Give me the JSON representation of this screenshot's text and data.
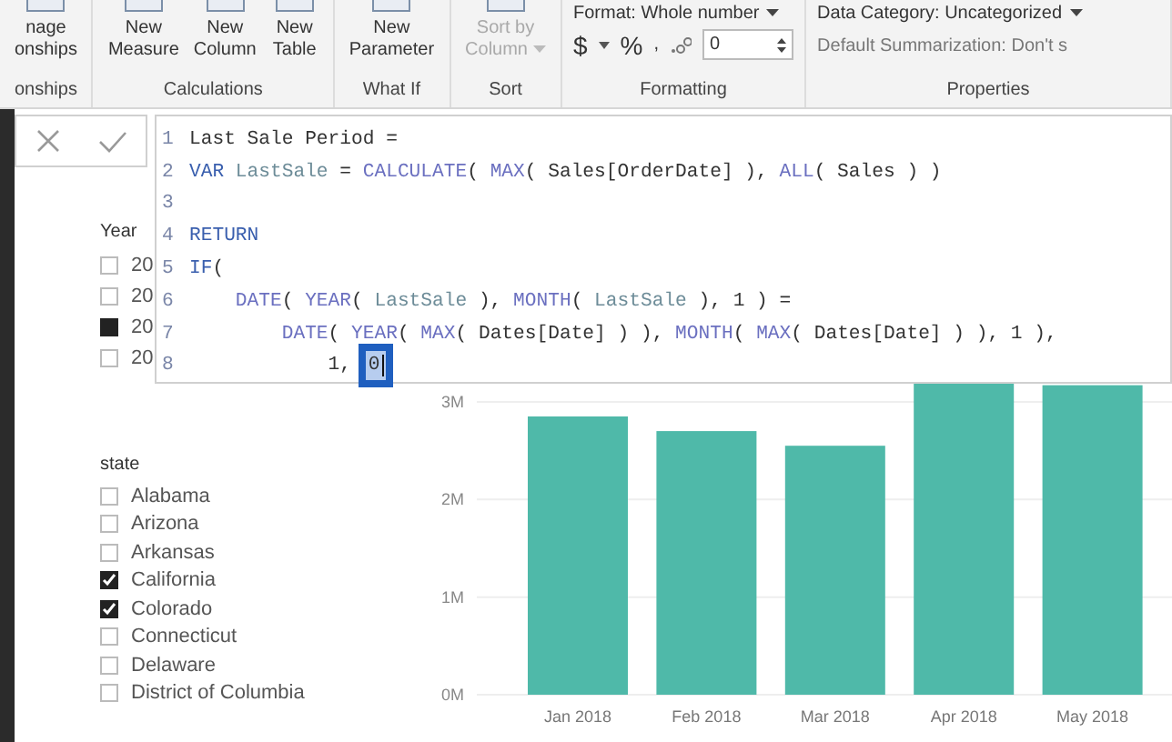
{
  "ribbon": {
    "groups": [
      {
        "kind": "buttons",
        "label": "onships",
        "buttons": [
          {
            "lines": [
              "nage",
              "onships"
            ],
            "disabled": false,
            "menu": false
          }
        ]
      },
      {
        "kind": "buttons",
        "label": "Calculations",
        "buttons": [
          {
            "lines": [
              "New",
              "Measure"
            ],
            "disabled": false,
            "menu": false
          },
          {
            "lines": [
              "New",
              "Column"
            ],
            "disabled": false,
            "menu": false
          },
          {
            "lines": [
              "New",
              "Table"
            ],
            "disabled": false,
            "menu": false
          }
        ]
      },
      {
        "kind": "buttons",
        "label": "What If",
        "buttons": [
          {
            "lines": [
              "New",
              "Parameter"
            ],
            "disabled": false,
            "menu": false
          }
        ]
      },
      {
        "kind": "buttons",
        "label": "Sort",
        "buttons": [
          {
            "lines": [
              "Sort by",
              "Column"
            ],
            "disabled": true,
            "menu": true
          }
        ]
      },
      {
        "kind": "formatting",
        "label": "Formatting",
        "format": "Format: Whole number",
        "currency": "$",
        "percent": "%",
        "comma": ",",
        "decimals": "0"
      },
      {
        "kind": "properties",
        "label": "Properties",
        "category": "Data Category: Uncategorized",
        "summarization": "Default Summarization: Don't s"
      }
    ]
  },
  "formula_bar": {
    "lines": [
      {
        "number": "1",
        "tokens": [
          {
            "kind": "text",
            "text": "Last Sale Period ="
          }
        ]
      },
      {
        "number": "2",
        "tokens": [
          {
            "kind": "keyword",
            "text": "VAR"
          },
          {
            "kind": "variable",
            "text": " LastSale"
          },
          {
            "kind": "text",
            "text": " = "
          },
          {
            "kind": "function",
            "text": "CALCULATE"
          },
          {
            "kind": "text",
            "text": "( "
          },
          {
            "kind": "function",
            "text": "MAX"
          },
          {
            "kind": "text",
            "text": "( Sales[OrderDate] ), "
          },
          {
            "kind": "function",
            "text": "ALL"
          },
          {
            "kind": "text",
            "text": "( Sales ) )"
          }
        ]
      },
      {
        "number": "3"
      },
      {
        "number": "4",
        "tokens": [
          {
            "kind": "keyword",
            "text": "RETURN"
          }
        ]
      },
      {
        "number": "5",
        "tokens": [
          {
            "kind": "keyword",
            "text": "IF"
          },
          {
            "kind": "text",
            "text": "("
          }
        ]
      },
      {
        "number": "6",
        "tokens": [
          {
            "kind": "function",
            "text": "    DATE"
          },
          {
            "kind": "text",
            "text": "( "
          },
          {
            "kind": "function",
            "text": "YEAR"
          },
          {
            "kind": "text",
            "text": "( "
          },
          {
            "kind": "variable",
            "text": "LastSale"
          },
          {
            "kind": "text",
            "text": " ), "
          },
          {
            "kind": "function",
            "text": "MONTH"
          },
          {
            "kind": "text",
            "text": "( "
          },
          {
            "kind": "variable",
            "text": "LastSale"
          },
          {
            "kind": "text",
            "text": " ), 1 ) ="
          }
        ]
      },
      {
        "number": "7",
        "tokens": [
          {
            "kind": "function",
            "text": "        DATE"
          },
          {
            "kind": "text",
            "text": "( "
          },
          {
            "kind": "function",
            "text": "YEAR"
          },
          {
            "kind": "text",
            "text": "( "
          },
          {
            "kind": "function",
            "text": "MAX"
          },
          {
            "kind": "text",
            "text": "( Dates[Date] ) ), "
          },
          {
            "kind": "function",
            "text": "MONTH"
          },
          {
            "kind": "text",
            "text": "( "
          },
          {
            "kind": "function",
            "text": "MAX"
          },
          {
            "kind": "text",
            "text": "( Dates[Date] ) ), 1 ),"
          }
        ]
      },
      {
        "number": "8",
        "tokens": [
          {
            "kind": "text",
            "text": "            1, "
          },
          {
            "kind": "selection",
            "text": "0"
          }
        ]
      }
    ]
  },
  "slicers": [
    {
      "title": "Year",
      "kind": "single_select",
      "items": [
        {
          "label": "20",
          "checked": false
        },
        {
          "label": "20",
          "checked": false
        },
        {
          "label": "20",
          "checked": true
        },
        {
          "label": "20",
          "checked": false
        }
      ]
    },
    {
      "title": "state",
      "kind": "multi_select",
      "items": [
        {
          "label": "Alabama",
          "checked": false
        },
        {
          "label": "Arizona",
          "checked": false
        },
        {
          "label": "Arkansas",
          "checked": false
        },
        {
          "label": "California",
          "checked": true
        },
        {
          "label": "Colorado",
          "checked": true
        },
        {
          "label": "Connecticut",
          "checked": false
        },
        {
          "label": "Delaware",
          "checked": false
        },
        {
          "label": "District of Columbia",
          "checked": false
        }
      ]
    }
  ],
  "chart": {
    "chart_data": {
      "type": "bar",
      "categories": [
        "Jan 2018",
        "Feb 2018",
        "Mar 2018",
        "Apr 2018",
        "May 2018"
      ],
      "series": [
        {
          "color": "#4fb9a9",
          "values": [
            2.85,
            2.7,
            2.55,
            3.2,
            3.17
          ]
        }
      ],
      "ylim": [
        0,
        3.2
      ],
      "grid": true,
      "yticks": [
        {
          "value": 0,
          "label": "0M"
        },
        {
          "value": 1,
          "label": "1M"
        },
        {
          "value": 2,
          "label": "2M"
        },
        {
          "value": 3,
          "label": "3M"
        }
      ]
    }
  }
}
